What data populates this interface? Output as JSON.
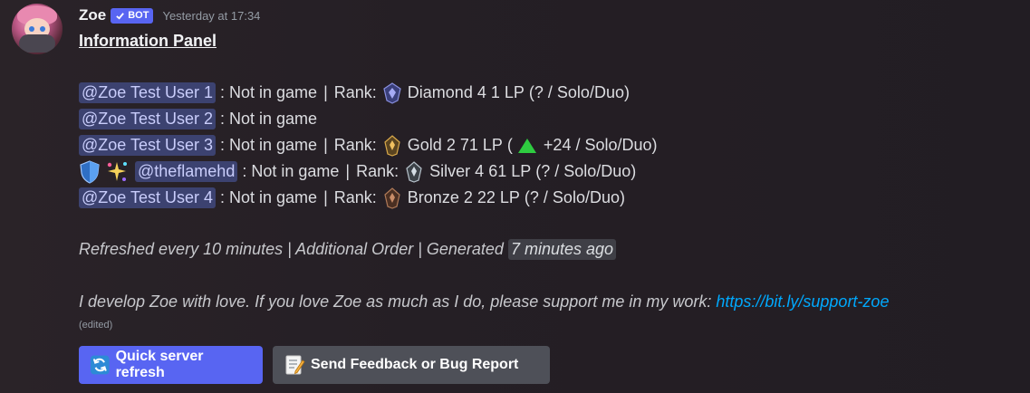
{
  "author": {
    "name": "Zoe",
    "bot_tag": "BOT",
    "timestamp": "Yesterday at 17:34"
  },
  "message": {
    "title": "Information Panel",
    "players": [
      {
        "mention": "@Zoe Test User 1",
        "status": "Not in game",
        "rank_label": "Rank:",
        "tier": "Diamond 4",
        "lp": "1 LP",
        "detail": "(? / Solo/Duo)",
        "rank_icon": "diamond-rank-icon"
      },
      {
        "mention": "@Zoe Test User 2",
        "status": "Not in game"
      },
      {
        "mention": "@Zoe Test User 3",
        "status": "Not in game",
        "rank_label": "Rank:",
        "tier": "Gold 2",
        "lp": "71 LP",
        "detail_open": "(",
        "trend": "+24 / Solo/Duo)",
        "rank_icon": "gold-rank-icon"
      },
      {
        "mention": "@theflamehd",
        "status": "Not in game",
        "rank_label": "Rank:",
        "tier": "Silver 4",
        "lp": "61 LP",
        "detail": "(? / Solo/Duo)",
        "rank_icon": "silver-rank-icon",
        "badges": [
          "shield-icon",
          "sparkle-icon"
        ]
      },
      {
        "mention": "@Zoe Test User 4",
        "status": "Not in game",
        "rank_label": "Rank:",
        "tier": "Bronze 2",
        "lp": "22 LP",
        "detail": "(? / Solo/Duo)",
        "rank_icon": "bronze-rank-icon"
      }
    ],
    "footer_line": "Refreshed every 10 minutes | Additional Order | Generated",
    "generated_ago": "7 minutes ago",
    "support_text": "I develop Zoe with love. If you love Zoe as much as I do, please support me in my work:",
    "support_link": "https://bit.ly/support-zoe",
    "edited": "(edited)"
  },
  "buttons": {
    "refresh_label": "Quick server refresh",
    "feedback_label": "Send Feedback or Bug Report"
  },
  "colors": {
    "accent": "#5865f2",
    "mention_bg": "#3c4270",
    "link": "#00a8fc",
    "trend_up": "#2ecc40"
  }
}
